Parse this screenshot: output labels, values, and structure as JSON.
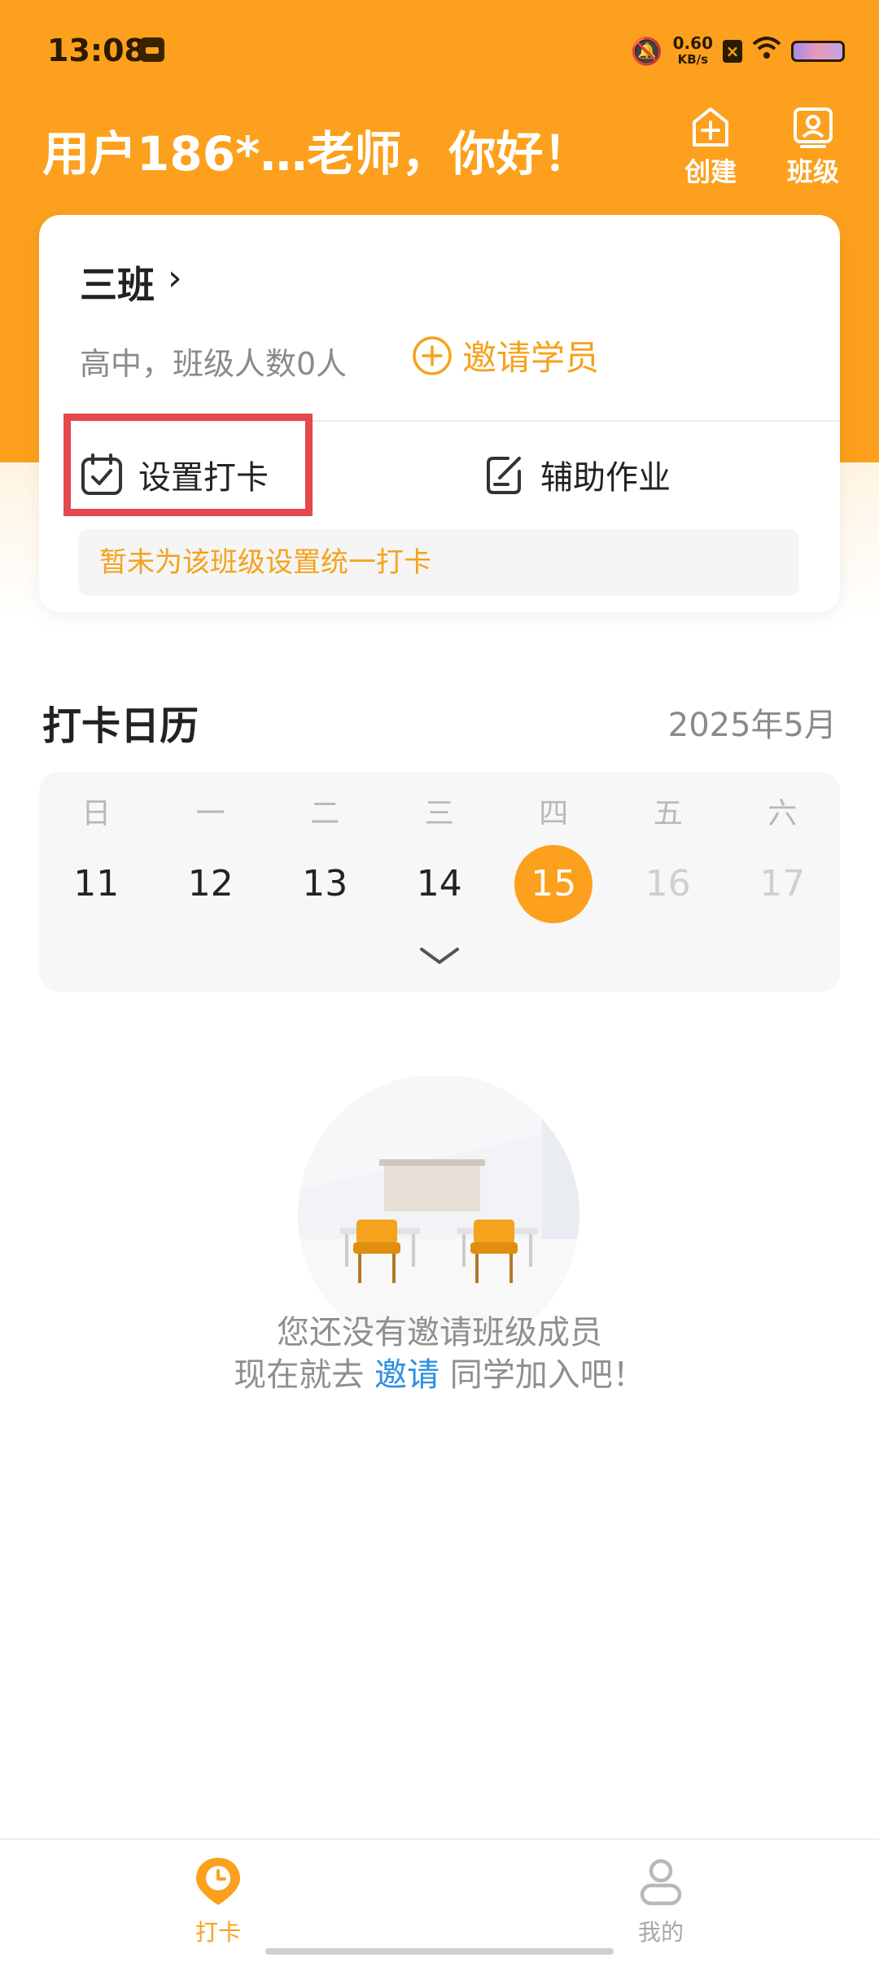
{
  "status_bar": {
    "time": "13:08",
    "net_speed": "0.60",
    "net_unit": "KB/s"
  },
  "header": {
    "greeting": "用户186*…老师，你好！",
    "create_label": "创建",
    "class_label": "班级"
  },
  "class_card": {
    "name": "三班",
    "info": "高中，班级人数0人",
    "invite_label": "邀请学员",
    "checkin_label": "设置打卡",
    "homework_label": "辅助作业",
    "notice": "暂未为该班级设置统一打卡"
  },
  "calendar": {
    "title": "打卡日历",
    "month": "2025年5月",
    "weekdays": [
      "日",
      "一",
      "二",
      "三",
      "四",
      "五",
      "六"
    ],
    "days": [
      "11",
      "12",
      "13",
      "14",
      "15",
      "16",
      "17"
    ],
    "selected_day": "15"
  },
  "empty_state": {
    "line1": "您还没有邀请班级成员",
    "line2_prefix": "现在就去",
    "line2_link": "邀请",
    "line2_suffix": "同学加入吧！"
  },
  "bottom_nav": {
    "checkin_label": "打卡",
    "mine_label": "我的"
  },
  "colors": {
    "brand": "#FCA01D",
    "link": "#2F8FE3",
    "highlight": "#E5484D"
  }
}
